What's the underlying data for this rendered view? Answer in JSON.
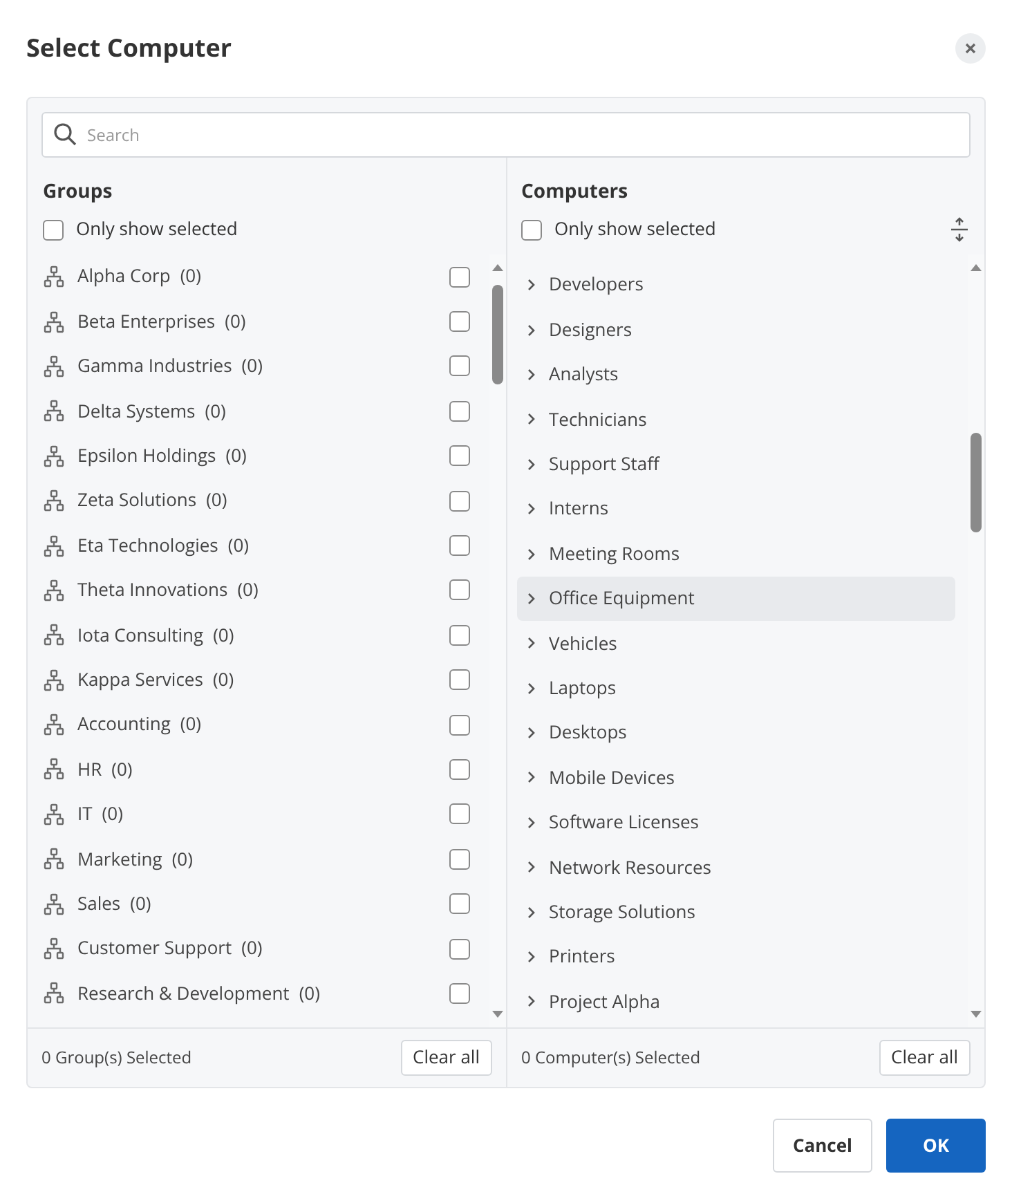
{
  "dialog": {
    "title": "Select Computer"
  },
  "search": {
    "placeholder": "Search"
  },
  "groups": {
    "heading": "Groups",
    "only_show_selected": {
      "label": "Only show selected",
      "checked": false
    },
    "items": [
      {
        "name": "Alpha Corp",
        "count": "(0)",
        "checked": false
      },
      {
        "name": "Beta Enterprises",
        "count": "(0)",
        "checked": false
      },
      {
        "name": "Gamma Industries",
        "count": "(0)",
        "checked": false
      },
      {
        "name": "Delta Systems",
        "count": "(0)",
        "checked": false
      },
      {
        "name": "Epsilon Holdings",
        "count": "(0)",
        "checked": false
      },
      {
        "name": "Zeta Solutions",
        "count": "(0)",
        "checked": false
      },
      {
        "name": "Eta Technologies",
        "count": "(0)",
        "checked": false
      },
      {
        "name": "Theta Innovations",
        "count": "(0)",
        "checked": false
      },
      {
        "name": "Iota Consulting",
        "count": "(0)",
        "checked": false
      },
      {
        "name": "Kappa Services",
        "count": "(0)",
        "checked": false
      },
      {
        "name": "Accounting",
        "count": "(0)",
        "checked": false
      },
      {
        "name": "HR",
        "count": "(0)",
        "checked": false
      },
      {
        "name": "IT",
        "count": "(0)",
        "checked": false
      },
      {
        "name": "Marketing",
        "count": "(0)",
        "checked": false
      },
      {
        "name": "Sales",
        "count": "(0)",
        "checked": false
      },
      {
        "name": "Customer Support",
        "count": "(0)",
        "checked": false
      },
      {
        "name": "Research & Development",
        "count": "(0)",
        "checked": false
      }
    ],
    "status": "0 Group(s) Selected",
    "clear": "Clear all"
  },
  "computers": {
    "heading": "Computers",
    "only_show_selected": {
      "label": "Only show selected",
      "checked": false
    },
    "items": [
      {
        "name": "Developers",
        "highlighted": false
      },
      {
        "name": "Designers",
        "highlighted": false
      },
      {
        "name": "Analysts",
        "highlighted": false
      },
      {
        "name": "Technicians",
        "highlighted": false
      },
      {
        "name": "Support Staff",
        "highlighted": false
      },
      {
        "name": "Interns",
        "highlighted": false
      },
      {
        "name": "Meeting Rooms",
        "highlighted": false
      },
      {
        "name": "Office Equipment",
        "highlighted": true
      },
      {
        "name": "Vehicles",
        "highlighted": false
      },
      {
        "name": "Laptops",
        "highlighted": false
      },
      {
        "name": "Desktops",
        "highlighted": false
      },
      {
        "name": "Mobile Devices",
        "highlighted": false
      },
      {
        "name": "Software Licenses",
        "highlighted": false
      },
      {
        "name": "Network Resources",
        "highlighted": false
      },
      {
        "name": "Storage Solutions",
        "highlighted": false
      },
      {
        "name": "Printers",
        "highlighted": false
      },
      {
        "name": "Project Alpha",
        "highlighted": false
      }
    ],
    "status": "0 Computer(s) Selected",
    "clear": "Clear all"
  },
  "buttons": [
    {
      "label": "Cancel",
      "kind": "secondary"
    },
    {
      "label": "OK",
      "kind": "primary"
    }
  ]
}
